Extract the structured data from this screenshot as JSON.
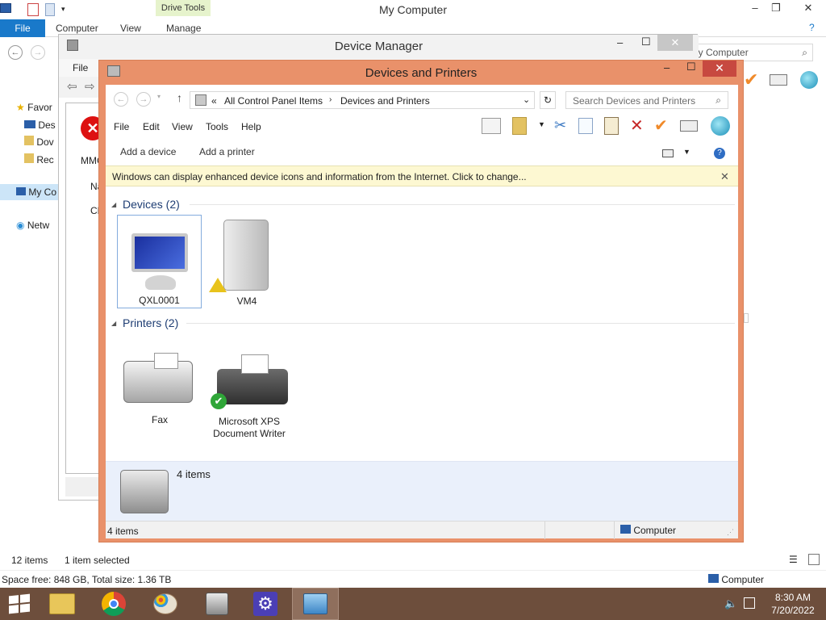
{
  "explorer": {
    "title": "My Computer",
    "drive_tools": "Drive Tools",
    "tabs": {
      "file": "File",
      "computer": "Computer",
      "view": "View",
      "manage": "Manage"
    },
    "search_placeholder": "ly Computer",
    "nav": {
      "favorites": "Favor",
      "desktop": "Des",
      "downloads": "Dov",
      "recent": "Rec",
      "mycomputer": "My Co",
      "network": "Netw"
    },
    "status_items": "12 items",
    "status_selected": "1 item selected",
    "space": "Space free: 848 GB, Total size: 1.36 TB",
    "computer_label": "Computer"
  },
  "device_manager": {
    "title": "Device Manager",
    "menu_file": "File",
    "mmc": "MMC",
    "na": "Na",
    "cl": "CL"
  },
  "devices_printers": {
    "title": "Devices and Printers",
    "breadcrumb_prefix": "«",
    "breadcrumb_1": "All Control Panel Items",
    "breadcrumb_2": "Devices and Printers",
    "search_placeholder": "Search Devices and Printers",
    "menu": {
      "file": "File",
      "edit": "Edit",
      "view": "View",
      "tools": "Tools",
      "help": "Help"
    },
    "commands": {
      "add_device": "Add a device",
      "add_printer": "Add a printer"
    },
    "info_bar": "Windows can display enhanced device icons and information from the Internet. Click to change...",
    "devices_group": "Devices (2)",
    "printers_group": "Printers (2)",
    "devices": [
      {
        "name": "QXL0001"
      },
      {
        "name": "VM4"
      }
    ],
    "printers": [
      {
        "name": "Fax"
      },
      {
        "name": "Microsoft XPS Document Writer"
      }
    ],
    "details_count": "4 items",
    "status_count": "4 items",
    "status_computer": "Computer"
  },
  "taskbar": {
    "time": "8:30 AM",
    "date": "7/20/2022"
  }
}
